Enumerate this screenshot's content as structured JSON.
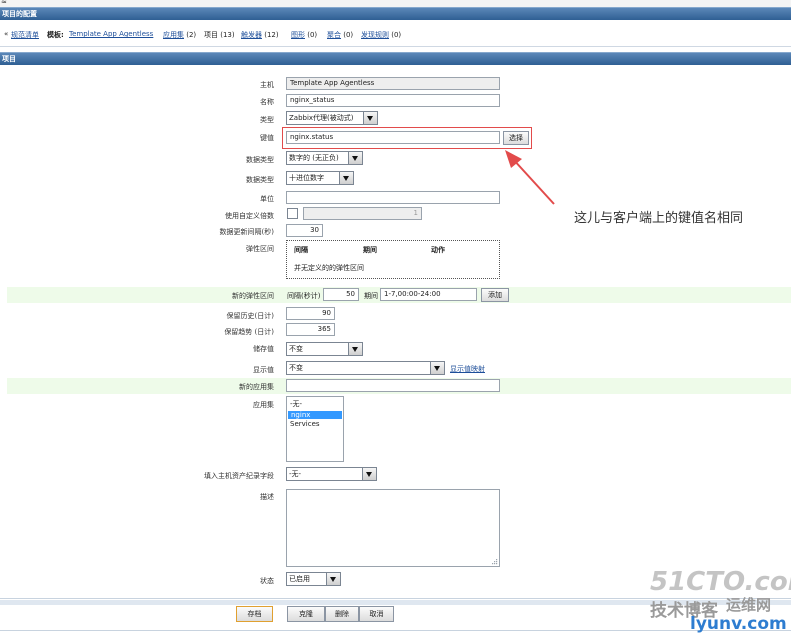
{
  "top_corner_text": "≈",
  "section_title": "项目的配置",
  "nav": {
    "back_prefix": "«",
    "back_link": "规范清单",
    "template_label": "模板:",
    "template_link": "Template App Agentless",
    "apps": {
      "label": "应用集",
      "count": "(2)"
    },
    "items": {
      "label": "项目",
      "count": "(13)"
    },
    "triggers": {
      "label": "触发器",
      "count": "(12)"
    },
    "graphs": {
      "label": "图形",
      "count": "(0)"
    },
    "screens": {
      "label": "聚合",
      "count": "(0)"
    },
    "discovery": {
      "label": "发现规则",
      "count": "(0)"
    }
  },
  "form_title": "项目",
  "fields": {
    "host": {
      "label": "主机",
      "value": "Template App Agentless"
    },
    "name": {
      "label": "名称",
      "value": "nginx_status"
    },
    "type": {
      "label": "类型",
      "value": "Zabbix代理(被动式)"
    },
    "key": {
      "label": "键值",
      "value": "nginx.status",
      "select_button": "选择"
    },
    "value_type": {
      "label": "数据类型",
      "value": "数字的 (无正负)"
    },
    "data_type": {
      "label": "数据类型",
      "value": "十进位数字"
    },
    "units": {
      "label": "单位",
      "value": ""
    },
    "multiplier": {
      "label": "使用自定义倍数",
      "value": "1"
    },
    "update_interval": {
      "label": "数据更新间隔(秒)",
      "value": "30"
    },
    "flexible_intervals": {
      "label": "弹性区间",
      "col_interval": "间隔",
      "col_period": "期间",
      "col_action": "动作",
      "empty_text": "并无定义的的弹性区间"
    },
    "new_flexible": {
      "label": "新的弹性区间",
      "interval_label": "间隔(秒计)",
      "interval_value": "50",
      "period_label": "期间",
      "period_value": "1-7,00:00-24:00",
      "add_button": "添加"
    },
    "history": {
      "label": "保留历史(日计)",
      "value": "90"
    },
    "trends": {
      "label": "保留趋势 (日计)",
      "value": "365"
    },
    "store_value": {
      "label": "储存值",
      "value": "不变"
    },
    "show_value": {
      "label": "显示值",
      "value": "不变",
      "link": "显示值映射"
    },
    "new_application": {
      "label": "新的应用集",
      "value": ""
    },
    "applications": {
      "label": "应用集",
      "options": [
        "-无-",
        "nginx",
        "Services"
      ],
      "selected": "nginx"
    },
    "inventory": {
      "label": "填入主机资产纪录字段",
      "value": "-无-"
    },
    "description": {
      "label": "描述",
      "value": ""
    },
    "status": {
      "label": "状态",
      "value": "已启用"
    }
  },
  "annotation": "这儿与客户端上的键值名相同",
  "buttons": {
    "save": "存档",
    "clone": "克隆",
    "delete": "删除",
    "cancel": "取消"
  },
  "watermarks": {
    "site1": "51CTO.com",
    "blog": "技术博客",
    "site2": "lyunv.com",
    "brand": "运维网"
  },
  "colors": {
    "header_bar": "#3a6aa0",
    "highlight_row": "#eefbe9",
    "annotation_red": "#e24b4b",
    "link": "#1d4e99"
  }
}
